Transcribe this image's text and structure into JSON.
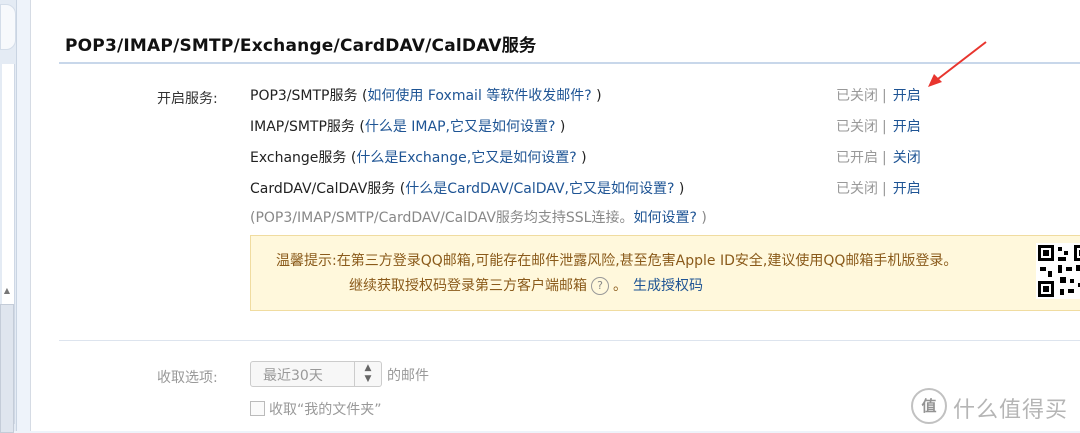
{
  "section": {
    "title": "POP3/IMAP/SMTP/Exchange/CardDAV/CalDAV服务"
  },
  "services": {
    "label": "开启服务:",
    "rows": [
      {
        "name": "POP3/SMTP服务",
        "open_paren": " (",
        "help": "如何使用 Foxmail 等软件收发邮件?",
        "close_paren": " )",
        "status": "已关闭",
        "sep": "|",
        "action": "开启"
      },
      {
        "name": "IMAP/SMTP服务",
        "open_paren": " (",
        "help": "什么是 IMAP,它又是如何设置?",
        "close_paren": " )",
        "status": "已关闭",
        "sep": "|",
        "action": "开启"
      },
      {
        "name": "Exchange服务",
        "open_paren": " (",
        "help": "什么是Exchange,它又是如何设置?",
        "close_paren": " )",
        "status": "已开启",
        "sep": "|",
        "action": "关闭"
      },
      {
        "name": "CardDAV/CalDAV服务",
        "open_paren": " (",
        "help": "什么是CardDAV/CalDAV,它又是如何设置?",
        "close_paren": " )",
        "status": "已关闭",
        "sep": "|",
        "action": "开启"
      }
    ],
    "ssl_note": "(POP3/IMAP/SMTP/CardDAV/CalDAV服务均支持SSL连接。",
    "ssl_link": "如何设置?",
    "ssl_close": " )"
  },
  "warning": {
    "line1": "温馨提示:在第三方登录QQ邮箱,可能存在邮件泄露风险,甚至危害Apple ID安全,建议使用QQ邮箱手机版登录。",
    "line2": "继续获取授权码登录第三方客户端邮箱",
    "help_icon": "?",
    "period": "。",
    "generate_link": "生成授权码"
  },
  "fetch": {
    "label": "收取选项:",
    "selected": "最近30天",
    "suffix": "的邮件",
    "checkbox_label": "收取“我的文件夹”"
  },
  "watermark": {
    "logo": "值",
    "text": "什么值得买"
  },
  "colors": {
    "link": "#1e5494",
    "annotation_arrow": "#e8352e",
    "warning_bg": "#fff8dc"
  }
}
